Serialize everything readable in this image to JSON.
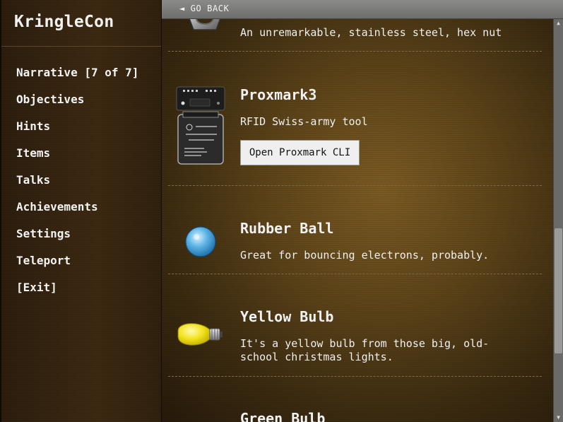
{
  "sidebar": {
    "brand": "KringleCon",
    "items": [
      {
        "label": "Narrative [7 of 7]"
      },
      {
        "label": "Objectives"
      },
      {
        "label": "Hints"
      },
      {
        "label": "Items"
      },
      {
        "label": "Talks"
      },
      {
        "label": "Achievements"
      },
      {
        "label": "Settings"
      },
      {
        "label": "Teleport"
      },
      {
        "label": "[Exit]"
      }
    ]
  },
  "header": {
    "back_label": "◄ GO BACK"
  },
  "items": {
    "hex_nut": {
      "description": "An unremarkable, stainless steel, hex nut",
      "icon": "hex-nut-icon"
    },
    "proxmark": {
      "name": "Proxmark3",
      "description": "RFID Swiss-army tool",
      "button_label": "Open Proxmark CLI",
      "icon": "proxmark-icon"
    },
    "rubber_ball": {
      "name": "Rubber Ball",
      "description": "Great for bouncing electrons, probably.",
      "icon": "rubber-ball-icon"
    },
    "yellow_bulb": {
      "name": "Yellow Bulb",
      "description": "It's a yellow bulb from those big, old-school christmas lights.",
      "icon": "yellow-bulb-icon"
    },
    "green_bulb": {
      "name": "Green Bulb"
    }
  },
  "colors": {
    "sidebar_bg": "#2e1f0c",
    "main_bg": "#5d4419",
    "topbar_bg": "#7a7a78",
    "button_bg": "#efefef"
  }
}
